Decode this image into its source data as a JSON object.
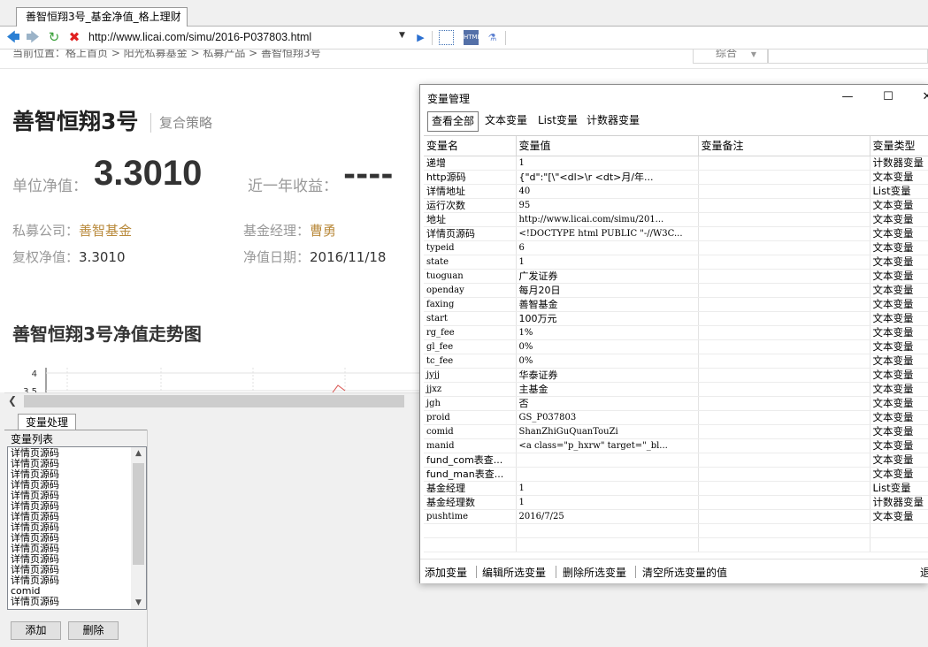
{
  "browser": {
    "tab_title": "善智恒翔3号_基金净值_格上理财",
    "url": "http://www.licai.com/simu/2016-P037803.html"
  },
  "page": {
    "breadcrumb": "当前位置：格上首页 > 阳光私募基金 > 私募产品 > 善智恒翔3号",
    "search_select": "综合",
    "fund_name": "善智恒翔3号",
    "strategy": "复合策略",
    "nav_label": "单位净值：",
    "nav_value": "3.3010",
    "return_label": "近一年收益：",
    "return_value": "----",
    "company_label": "私募公司：",
    "company_value": "善智基金",
    "manager_label": "基金经理：",
    "manager_value": "曹勇",
    "adj_nav_label": "复权净值：",
    "adj_nav_value": "3.3010",
    "nav_date_label": "净值日期：",
    "nav_date_value": "2016/11/18",
    "chart_title": "善智恒翔3号净值走势图"
  },
  "chart_data": {
    "type": "line",
    "title": "善智恒翔3号净值走势图",
    "yticks": [
      "4",
      "3.5"
    ],
    "ylim": [
      3.5,
      4
    ],
    "grid": true
  },
  "panel": {
    "tab_label": "变量处理",
    "list_label": "变量列表",
    "list_items": [
      "详情页源码",
      "详情页源码",
      "详情页源码",
      "详情页源码",
      "详情页源码",
      "详情页源码",
      "详情页源码",
      "详情页源码",
      "详情页源码",
      "详情页源码",
      "详情页源码",
      "详情页源码",
      "详情页源码",
      "comid",
      "详情页源码"
    ],
    "add_button": "添加",
    "delete_button": "删除"
  },
  "dialog": {
    "title": "变量管理",
    "tabs": [
      "查看全部",
      "文本变量",
      "List变量",
      "计数器变量"
    ],
    "columns": [
      "变量名",
      "变量值",
      "变量备注",
      "变量类型"
    ],
    "rows": [
      {
        "name": "递增",
        "value": "1",
        "note": "",
        "type": "计数器变量"
      },
      {
        "name": "http源码",
        "value": "{\"d\":\"[\\\"<dl>\\r    <dt>月/年...",
        "note": "",
        "type": "文本变量"
      },
      {
        "name": "详情地址",
        "value": "40",
        "note": "",
        "type": "List变量"
      },
      {
        "name": "运行次数",
        "value": "95",
        "note": "",
        "type": "文本变量"
      },
      {
        "name": "地址",
        "value": "http://www.licai.com/simu/201...",
        "note": "",
        "type": "文本变量"
      },
      {
        "name": "详情页源码",
        "value": "<!DOCTYPE html PUBLIC \"-//W3C...",
        "note": "",
        "type": "文本变量"
      },
      {
        "name": "typeid",
        "value": "6",
        "note": "",
        "type": "文本变量"
      },
      {
        "name": "state",
        "value": "1",
        "note": "",
        "type": "文本变量"
      },
      {
        "name": "tuoguan",
        "value": "广发证券",
        "note": "",
        "type": "文本变量"
      },
      {
        "name": "openday",
        "value": "每月20日",
        "note": "",
        "type": "文本变量"
      },
      {
        "name": "faxing",
        "value": "善智基金",
        "note": "",
        "type": "文本变量"
      },
      {
        "name": "start",
        "value": "100万元",
        "note": "",
        "type": "文本变量"
      },
      {
        "name": "rg_fee",
        "value": "1%",
        "note": "",
        "type": "文本变量"
      },
      {
        "name": "gl_fee",
        "value": "0%",
        "note": "",
        "type": "文本变量"
      },
      {
        "name": "tc_fee",
        "value": "0%",
        "note": "",
        "type": "文本变量"
      },
      {
        "name": "jyjj",
        "value": "华泰证券",
        "note": "",
        "type": "文本变量"
      },
      {
        "name": "jjxz",
        "value": "主基金",
        "note": "",
        "type": "文本变量"
      },
      {
        "name": "jgh",
        "value": "否",
        "note": "",
        "type": "文本变量"
      },
      {
        "name": "proid",
        "value": "GS_P037803",
        "note": "",
        "type": "文本变量"
      },
      {
        "name": "comid",
        "value": "ShanZhiGuQuanTouZi",
        "note": "",
        "type": "文本变量"
      },
      {
        "name": "manid",
        "value": "<a class=\"p_hxrw\" target=\"_bl...",
        "note": "",
        "type": "文本变量"
      },
      {
        "name": "fund_com表查...",
        "value": "",
        "note": "",
        "type": "文本变量"
      },
      {
        "name": "fund_man表查...",
        "value": "",
        "note": "",
        "type": "文本变量"
      },
      {
        "name": "基金经理",
        "value": "1",
        "note": "",
        "type": "List变量"
      },
      {
        "name": "基金经理数",
        "value": "1",
        "note": "",
        "type": "计数器变量"
      },
      {
        "name": "pushtime",
        "value": "2016/7/25",
        "note": "",
        "type": "文本变量"
      },
      {
        "name": "",
        "value": "",
        "note": "",
        "type": ""
      },
      {
        "name": "",
        "value": "",
        "note": "",
        "type": ""
      }
    ],
    "footer": {
      "add": "添加变量",
      "edit": "编辑所选变量",
      "delete": "删除所选变量",
      "clear": "清空所选变量的值",
      "exit": "退"
    }
  }
}
